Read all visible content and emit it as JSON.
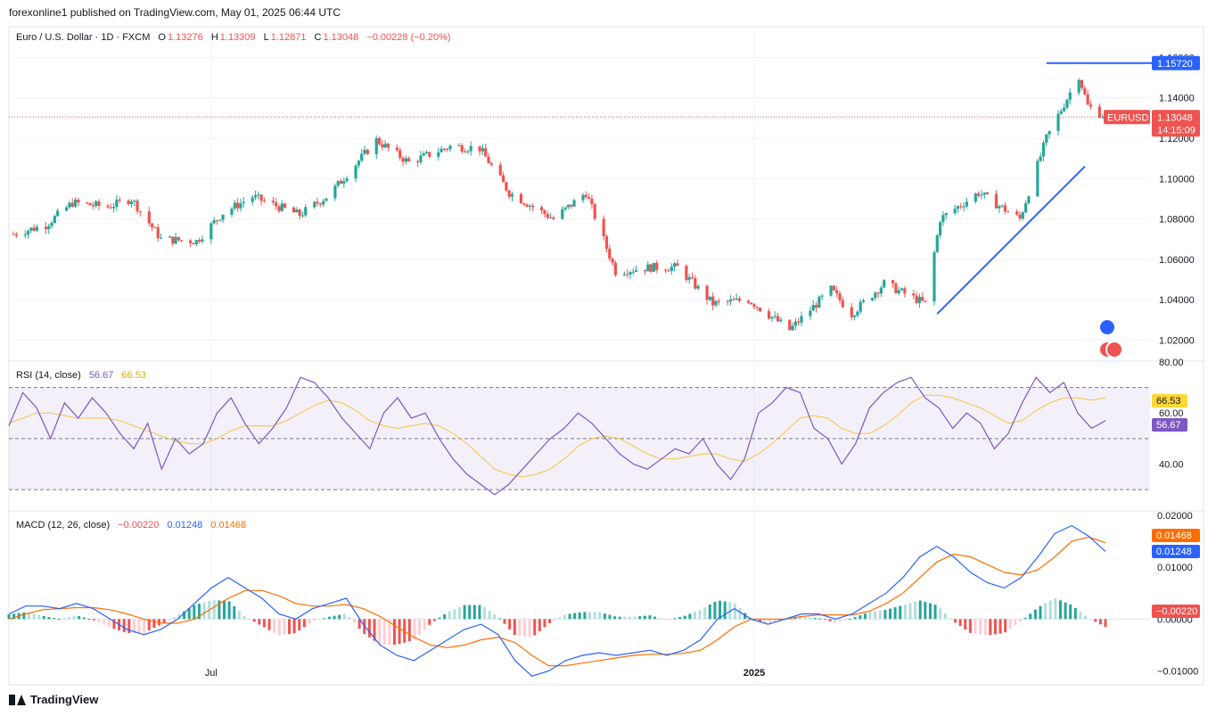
{
  "header": {
    "published": "forexonline1 published on TradingView.com, May 01, 2025 06:44 UTC"
  },
  "legend": {
    "symbol": "Euro / U.S. Dollar · 1D · FXCM",
    "o_label": "O",
    "o": "1.13276",
    "h_label": "H",
    "h": "1.13309",
    "l_label": "L",
    "l": "1.12871",
    "c_label": "C",
    "c": "1.13048",
    "change": "−0.00228 (−0.20%)"
  },
  "rsi_legend": {
    "name": "RSI (14, close)",
    "rsi": "56.67",
    "ma": "66.53"
  },
  "macd_legend": {
    "name": "MACD (12, 26, close)",
    "hist": "−0.00220",
    "macd": "0.01248",
    "signal": "0.01468"
  },
  "footer": {
    "brand": "TradingView"
  },
  "colors": {
    "up": "#26a69a",
    "down": "#ef5350",
    "rsi": "#7e57c2",
    "rsi_ma": "#fdd835",
    "macd": "#2962ff",
    "signal": "#ff6d00",
    "trend": "#2962ff"
  },
  "chart_data": [
    {
      "type": "candlestick",
      "title": "Euro / U.S. Dollar · 1D · FXCM",
      "ylim": [
        1.01,
        1.1655
      ],
      "yticks": [
        "1.02000",
        "1.04000",
        "1.06000",
        "1.08000",
        "1.10000",
        "1.12000",
        "1.14000",
        "1.16000"
      ],
      "xtick_labels": [
        {
          "label": "Jul",
          "date": "2024-07-01"
        },
        {
          "label": "2025",
          "date": "2025-01-01"
        }
      ],
      "x_range": [
        "2024-04-25",
        "2025-04-30"
      ],
      "price_tags": [
        {
          "label": "1.15720",
          "value": 1.1572,
          "color": "#2962ff"
        },
        {
          "label": "EURUSD",
          "value": 1.13048,
          "color": "#ef5350",
          "extra": "1.13048",
          "countdown": "14:15:09"
        }
      ],
      "anchors": [
        [
          "2024-04-25",
          1.0725
        ],
        [
          "2024-05-06",
          1.077
        ],
        [
          "2024-05-15",
          1.088
        ],
        [
          "2024-05-27",
          1.086
        ],
        [
          "2024-06-04",
          1.09
        ],
        [
          "2024-06-14",
          1.07
        ],
        [
          "2024-06-26",
          1.069
        ],
        [
          "2024-07-05",
          1.083
        ],
        [
          "2024-07-15",
          1.091
        ],
        [
          "2024-07-31",
          1.082
        ],
        [
          "2024-08-10",
          1.092
        ],
        [
          "2024-08-26",
          1.119
        ],
        [
          "2024-09-06",
          1.108
        ],
        [
          "2024-09-20",
          1.116
        ],
        [
          "2024-09-30",
          1.115
        ],
        [
          "2024-10-10",
          1.093
        ],
        [
          "2024-10-25",
          1.08
        ],
        [
          "2024-11-05",
          1.093
        ],
        [
          "2024-11-15",
          1.054
        ],
        [
          "2024-11-27",
          1.056
        ],
        [
          "2024-12-06",
          1.056
        ],
        [
          "2024-12-18",
          1.038
        ],
        [
          "2024-12-30",
          1.04
        ],
        [
          "2025-01-13",
          1.025
        ],
        [
          "2025-01-27",
          1.045
        ],
        [
          "2025-02-03",
          1.033
        ],
        [
          "2025-02-14",
          1.048
        ],
        [
          "2025-02-28",
          1.038
        ],
        [
          "2025-03-05",
          1.08
        ],
        [
          "2025-03-18",
          1.093
        ],
        [
          "2025-04-01",
          1.08
        ],
        [
          "2025-04-10",
          1.12
        ],
        [
          "2025-04-21",
          1.151
        ],
        [
          "2025-04-24",
          1.136
        ],
        [
          "2025-04-30",
          1.1305
        ]
      ],
      "trendlines": [
        {
          "from": [
            "2025-03-04",
            1.033
          ],
          "to": [
            "2025-04-23",
            1.106
          ],
          "color": "#2962ff"
        },
        {
          "from": [
            "2025-04-10",
            1.1572
          ],
          "to": [
            "2025-04-30",
            1.1572
          ],
          "color": "#2962ff"
        }
      ]
    },
    {
      "type": "line",
      "title": "RSI (14, close)",
      "ylim": [
        22,
        80
      ],
      "yticks": [
        "40.00",
        "60.00",
        "80.00"
      ],
      "bands": [
        30,
        50,
        70
      ],
      "tags": [
        {
          "label": "66.53",
          "color": "#fdd835"
        },
        {
          "label": "56.67",
          "color": "#7e57c2"
        }
      ],
      "series": [
        {
          "name": "RSI",
          "values": [
            55,
            68,
            62,
            50,
            64,
            58,
            66,
            60,
            52,
            46,
            56,
            38,
            50,
            44,
            48,
            60,
            66,
            56,
            48,
            54,
            62,
            74,
            72,
            66,
            58,
            52,
            46,
            60,
            66,
            58,
            60,
            50,
            42,
            36,
            32,
            28,
            32,
            38,
            44,
            50,
            54,
            60,
            56,
            50,
            44,
            40,
            38,
            42,
            46,
            44,
            50,
            40,
            34,
            42,
            60,
            64,
            70,
            68,
            54,
            50,
            40,
            48,
            62,
            68,
            72,
            74,
            66,
            62,
            54,
            60,
            56,
            46,
            52,
            64,
            74,
            68,
            72,
            60,
            54,
            57
          ]
        },
        {
          "name": "MA",
          "values": [
            56,
            58,
            60,
            60,
            59,
            58,
            58,
            58,
            57,
            55,
            53,
            51,
            49,
            48,
            48,
            50,
            53,
            55,
            55,
            55,
            57,
            60,
            63,
            65,
            64,
            61,
            57,
            55,
            54,
            55,
            56,
            55,
            52,
            48,
            43,
            38,
            36,
            35,
            36,
            38,
            42,
            47,
            50,
            51,
            50,
            47,
            44,
            42,
            42,
            43,
            44,
            44,
            42,
            41,
            44,
            48,
            53,
            58,
            59,
            58,
            54,
            52,
            52,
            55,
            59,
            64,
            67,
            67,
            66,
            64,
            62,
            59,
            56,
            57,
            61,
            64,
            66,
            66,
            65,
            66
          ]
        }
      ]
    },
    {
      "type": "macd",
      "title": "MACD (12, 26, close)",
      "ylim": [
        -0.0125,
        0.0205
      ],
      "yticks": [
        "−0.01000",
        "0.00000",
        "0.01000",
        "0.02000"
      ],
      "tags": [
        {
          "label": "0.01468",
          "color": "#ff6d00"
        },
        {
          "label": "0.01248",
          "color": "#2962ff"
        },
        {
          "label": "−0.00220",
          "color": "#ef5350"
        }
      ],
      "series": [
        {
          "name": "MACD",
          "values": [
            0.001,
            0.0025,
            0.0025,
            0.002,
            0.003,
            0.002,
            0.0,
            -0.002,
            -0.003,
            -0.002,
            0.0,
            0.003,
            0.006,
            0.008,
            0.006,
            0.004,
            0.001,
            0.0,
            0.002,
            0.003,
            0.004,
            -0.001,
            -0.005,
            -0.007,
            -0.008,
            -0.006,
            -0.004,
            -0.002,
            -0.001,
            -0.003,
            -0.008,
            -0.011,
            -0.01,
            -0.008,
            -0.007,
            -0.0065,
            -0.007,
            -0.0065,
            -0.006,
            -0.007,
            -0.006,
            -0.004,
            0.0,
            0.002,
            0.0,
            -0.001,
            0.0,
            0.001,
            0.001,
            0.0,
            0.001,
            0.003,
            0.005,
            0.008,
            0.012,
            0.014,
            0.012,
            0.009,
            0.007,
            0.006,
            0.008,
            0.012,
            0.0165,
            0.018,
            0.016,
            0.013
          ]
        },
        {
          "name": "Signal",
          "values": [
            0.0,
            0.001,
            0.0018,
            0.002,
            0.0022,
            0.0022,
            0.0018,
            0.001,
            0.0,
            -0.0008,
            -0.0008,
            0.0,
            0.002,
            0.004,
            0.0055,
            0.0055,
            0.0045,
            0.003,
            0.0025,
            0.0025,
            0.0028,
            0.002,
            0.0005,
            -0.0015,
            -0.0035,
            -0.005,
            -0.0055,
            -0.005,
            -0.004,
            -0.0035,
            -0.0045,
            -0.007,
            -0.009,
            -0.009,
            -0.0085,
            -0.008,
            -0.0075,
            -0.007,
            -0.0068,
            -0.0068,
            -0.0066,
            -0.006,
            -0.004,
            -0.0015,
            0.0,
            0.0,
            0.0,
            0.0005,
            0.0008,
            0.0008,
            0.0008,
            0.0015,
            0.003,
            0.005,
            0.008,
            0.011,
            0.0125,
            0.012,
            0.0105,
            0.009,
            0.0085,
            0.0095,
            0.012,
            0.015,
            0.0158,
            0.0147
          ]
        }
      ]
    }
  ]
}
